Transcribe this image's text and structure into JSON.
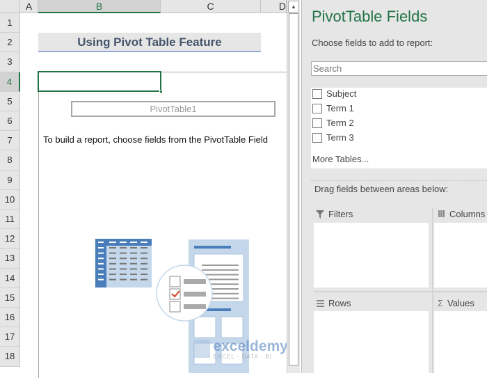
{
  "sheet": {
    "columns": [
      "A",
      "B",
      "C",
      "D"
    ],
    "selected_column": "B",
    "rows": [
      "1",
      "2",
      "3",
      "4",
      "5",
      "6",
      "7",
      "8",
      "9",
      "10",
      "11",
      "12",
      "13",
      "14",
      "15",
      "16",
      "17",
      "18"
    ],
    "selected_row": "4",
    "title": "Using Pivot Table Feature",
    "pivot_name": "PivotTable1",
    "instruction": "To build a report, choose fields from the PivotTable Field"
  },
  "panel": {
    "title": "PivotTable Fields",
    "subtitle": "Choose fields to add to report:",
    "search_placeholder": "Search",
    "fields": [
      {
        "label": "Subject",
        "checked": false
      },
      {
        "label": "Term 1",
        "checked": false
      },
      {
        "label": "Term 2",
        "checked": false
      },
      {
        "label": "Term 3",
        "checked": false
      }
    ],
    "more_tables": "More Tables...",
    "drag_label": "Drag fields between areas below:",
    "areas": {
      "filters": "Filters",
      "columns": "Columns",
      "rows": "Rows",
      "values": "Values"
    }
  },
  "watermark": {
    "brand": "exceldemy",
    "tagline": "EXCEL · DATA · BI"
  },
  "colors": {
    "accent": "#217346",
    "title_bg": "#e7e6e6",
    "title_border": "#8eaadb",
    "illustration_blue": "#4a7ebb"
  }
}
